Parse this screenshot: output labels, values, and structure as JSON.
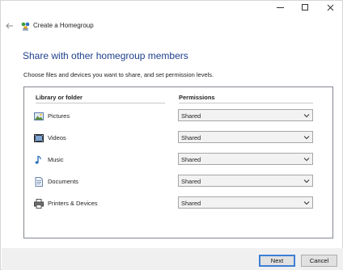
{
  "window": {
    "nav_title": "Create a Homegroup"
  },
  "main": {
    "heading": "Share with other homegroup members",
    "subtext": "Choose files and devices you want to share, and set permission levels.",
    "columns": {
      "library": "Library or folder",
      "permissions": "Permissions"
    },
    "rows": [
      {
        "label": "Pictures",
        "icon": "pictures-icon",
        "permission": "Shared"
      },
      {
        "label": "Videos",
        "icon": "videos-icon",
        "permission": "Shared"
      },
      {
        "label": "Music",
        "icon": "music-icon",
        "permission": "Shared"
      },
      {
        "label": "Documents",
        "icon": "documents-icon",
        "permission": "Shared"
      },
      {
        "label": "Printers & Devices",
        "icon": "printer-icon",
        "permission": "Shared"
      }
    ]
  },
  "footer": {
    "next_label": "Next",
    "cancel_label": "Cancel"
  },
  "colors": {
    "heading": "#1e3f8c",
    "default_button_border": "#3c7fd6"
  }
}
